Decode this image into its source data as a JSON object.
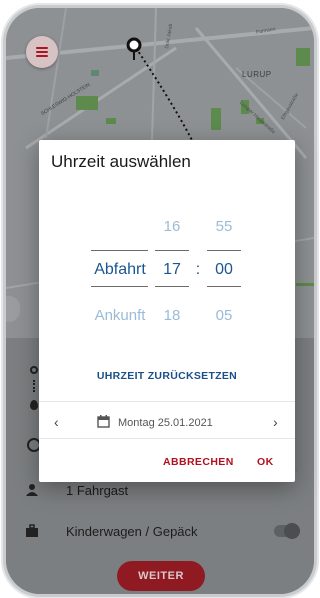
{
  "map": {
    "labels": {
      "lurup": "LURUP",
      "schleswig_holstein": "SCHLESWIG-HOLSTEIN",
      "street_a": "Farmsen",
      "street_b": "Dole Jakob",
      "street_c": "Luruper Hauptstraße",
      "street_d": "Elbgaustraße"
    }
  },
  "dialog": {
    "title": "Uhrzeit auswählen",
    "picker": {
      "mode_active": "Abfahrt",
      "mode_other": "Ankunft",
      "hours": {
        "prev": "16",
        "current": "17",
        "next": "18"
      },
      "minutes": {
        "prev": "55",
        "current": "00",
        "next": "05"
      },
      "separator": ":"
    },
    "reset_label": "UHRZEIT ZURÜCKSETZEN",
    "date": {
      "prev_symbol": "‹",
      "next_symbol": "›",
      "label": "Montag 25.01.2021"
    },
    "cancel_label": "ABBRECHEN",
    "ok_label": "OK"
  },
  "app": {
    "passengers_label": "1 Fahrgast",
    "luggage_label": "Kinderwagen / Gepäck",
    "weiter_label": "WEITER"
  },
  "colors": {
    "accent_red": "#b3101f",
    "accent_blue": "#1c5591",
    "faded_blue": "#9bbbd6"
  }
}
